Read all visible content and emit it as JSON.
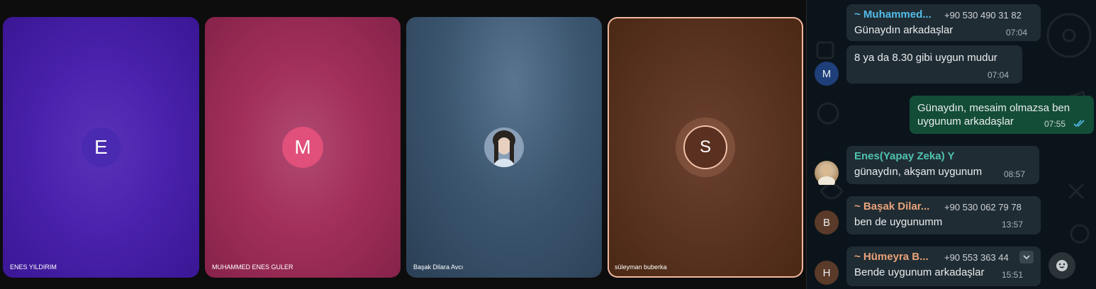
{
  "tiles": [
    {
      "name": "ENES YILDIRIM",
      "initial": "E"
    },
    {
      "name": "MUHAMMED ENES GULER",
      "initial": "M"
    },
    {
      "name": "Başak Dilara Avcı"
    },
    {
      "name": "süleyman buberka",
      "initial": "S"
    }
  ],
  "chat": {
    "messages": [
      {
        "sender": "~ Muhammed...",
        "phone": "+90 530 490 31 82",
        "text": "Günaydın arkadaşlar",
        "time": "07:04",
        "sender_color": "#53bdeb"
      },
      {
        "text": "8 ya da 8.30 gibi uygun mudur",
        "time": "07:04",
        "avatar_initial": "M"
      },
      {
        "text_line1": "Günaydın, mesaim olmazsa ben",
        "text_line2": "uygunum arkadaşlar",
        "time": "07:55"
      },
      {
        "sender": "Enes(Yapay Zeka) Y",
        "text": "günaydın, akşam uygunum",
        "time": "08:57",
        "sender_color": "#4fc3b0"
      },
      {
        "sender": "~ Başak Dilar...",
        "phone": "+90 530 062 79 78",
        "text": "ben de uygunumm",
        "time": "13:57",
        "avatar_initial": "B",
        "sender_color": "#e9a27a"
      },
      {
        "sender": "~ Hümeyra B...",
        "phone": "+90 553 363 44",
        "text": "Bende uygunum arkadaşlar",
        "time": "15:51",
        "avatar_initial": "H",
        "sender_color": "#e9a27a"
      }
    ]
  },
  "icons": {
    "read_receipt": "double-check-icon",
    "menu": "chevron-down-icon",
    "emoji": "emoji-icon"
  },
  "colors": {
    "outgoing_bubble": "#144d37",
    "incoming_bubble": "#202c33",
    "read_check": "#53bdeb",
    "active_speaker_border": "#f0b8a0"
  }
}
